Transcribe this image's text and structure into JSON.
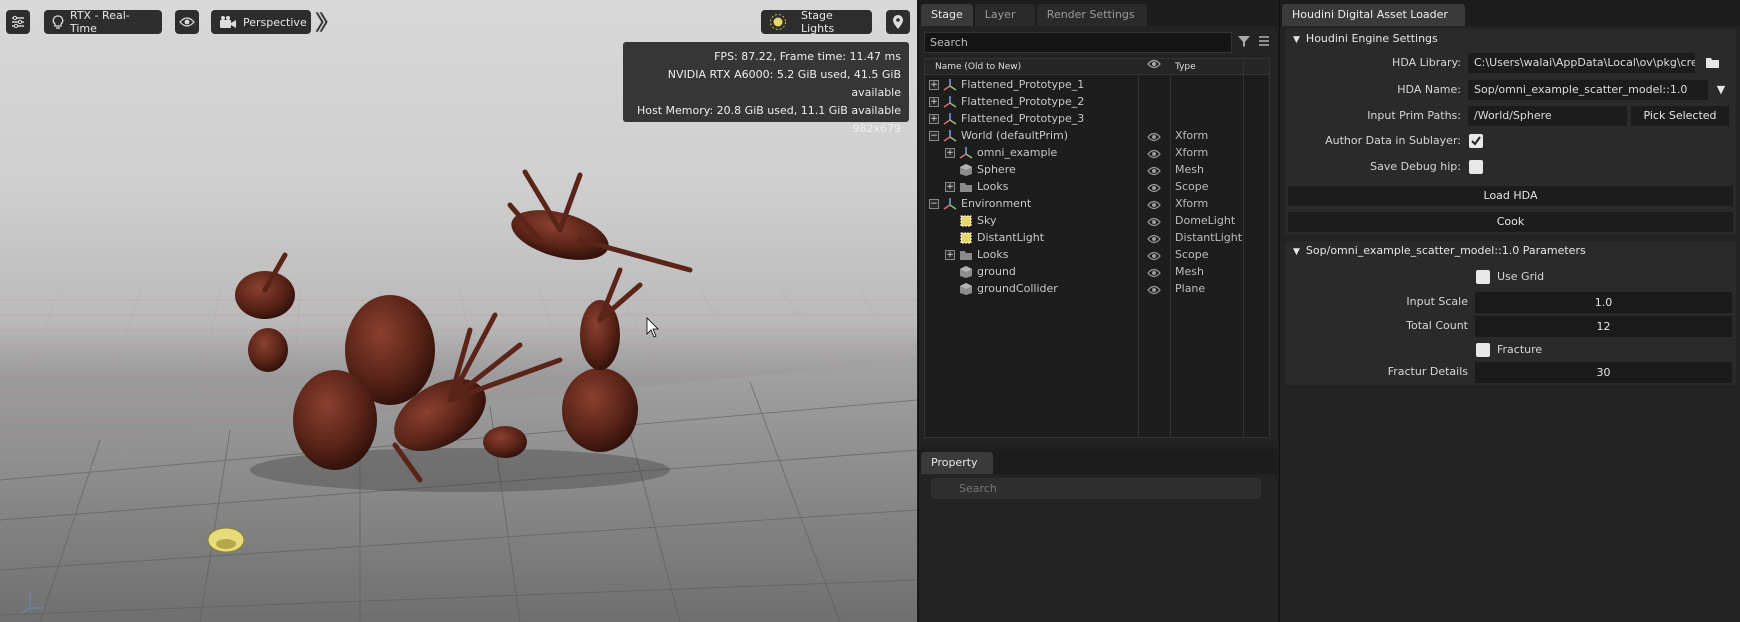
{
  "viewport": {
    "renderer_label": "RTX - Real-Time",
    "camera_label": "Perspective",
    "lights_label": "Stage Lights",
    "stats": {
      "fps": "FPS: 87.22, Frame time: 11.47 ms",
      "gpu": "NVIDIA RTX A6000: 5.2 GiB used, 41.5 GiB available",
      "host": "Host Memory: 20.8 GiB used, 11.1 GiB available",
      "resolution": "982x679"
    }
  },
  "stage": {
    "tabs": [
      "Stage",
      "Layer",
      "Render Settings"
    ],
    "search_placeholder": "Search",
    "columns": {
      "name": "Name (Old to New)",
      "type": "Type"
    },
    "rows": [
      {
        "name": "Flattened_Prototype_1",
        "type": "",
        "icon": "xform-icon",
        "expander": "+",
        "eye": false
      },
      {
        "name": "Flattened_Prototype_2",
        "type": "",
        "icon": "xform-icon",
        "expander": "+",
        "eye": false
      },
      {
        "name": "Flattened_Prototype_3",
        "type": "",
        "icon": "xform-icon",
        "expander": "+",
        "eye": false
      },
      {
        "name": "World (defaultPrim)",
        "type": "Xform",
        "icon": "xform-icon",
        "expander": "-",
        "eye": true
      },
      {
        "name": "omni_example",
        "type": "Xform",
        "icon": "xform-icon",
        "expander": "+",
        "eye": true
      },
      {
        "name": "Sphere",
        "type": "Mesh",
        "icon": "mesh-icon",
        "expander": "",
        "eye": true
      },
      {
        "name": "Looks",
        "type": "Scope",
        "icon": "folder-icon",
        "expander": "+",
        "eye": true
      },
      {
        "name": "Environment",
        "type": "Xform",
        "icon": "xform-icon",
        "expander": "-",
        "eye": true
      },
      {
        "name": "Sky",
        "type": "DomeLight",
        "icon": "light-icon",
        "expander": "",
        "eye": true
      },
      {
        "name": "DistantLight",
        "type": "DistantLight",
        "icon": "light-icon",
        "expander": "",
        "eye": true
      },
      {
        "name": "Looks",
        "type": "Scope",
        "icon": "folder-icon",
        "expander": "+",
        "eye": true
      },
      {
        "name": "ground",
        "type": "Mesh",
        "icon": "mesh-icon",
        "expander": "",
        "eye": true
      },
      {
        "name": "groundCollider",
        "type": "Plane",
        "icon": "mesh-icon",
        "expander": "",
        "eye": true
      }
    ]
  },
  "property": {
    "tab": "Property",
    "search_placeholder": "Search"
  },
  "hda": {
    "tab": "Houdini Digital Asset Loader",
    "engine_header": "Houdini Engine Settings",
    "library_label": "HDA Library:",
    "library_value": "C:\\Users\\walai\\AppData\\Local\\ov\\pkg\\crea",
    "name_label": "HDA Name:",
    "name_value": "Sop/omni_example_scatter_model::1.0",
    "prim_label": "Input Prim Paths:",
    "prim_value": "/World/Sphere",
    "pick_button": "Pick Selected",
    "sublayer_label": "Author Data in Sublayer:",
    "debug_label": "Save Debug hip:",
    "load_button": "Load HDA",
    "cook_button": "Cook",
    "params_header": "Sop/omni_example_scatter_model::1.0 Parameters",
    "use_grid_label": "Use Grid",
    "input_scale_label": "Input Scale",
    "input_scale_value": "1.0",
    "total_count_label": "Total Count",
    "total_count_value": "12",
    "fracture_label": "Fracture",
    "fractur_details_label": "Fractur Details",
    "fractur_details_value": "30"
  },
  "colors": {
    "panel_bg": "#232323",
    "accent_check": "#e8e8e8",
    "prim_brown": "#5a2418"
  }
}
